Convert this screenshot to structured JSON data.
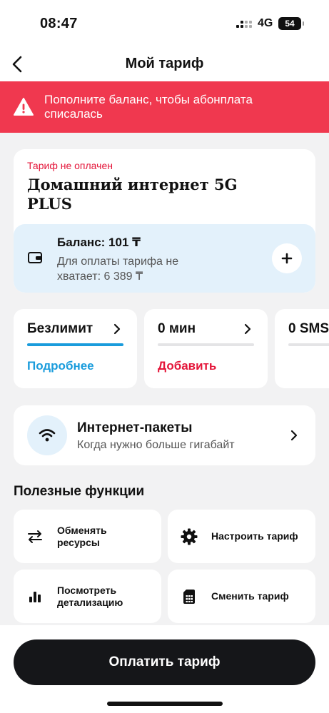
{
  "status_bar": {
    "time": "08:47",
    "network": "4G",
    "battery": "54"
  },
  "nav": {
    "title": "Мой тариф"
  },
  "alert": {
    "text": "Пополните баланс, чтобы абонплата списалась",
    "color": "#f0384f"
  },
  "tariff": {
    "status": "Тариф не оплачен",
    "name": "Домашний интернет 5G PLUS",
    "balance_title": "Баланс: 101 ₸",
    "balance_note": "Для оплаты тарифа не хватает: 6 389 ₸"
  },
  "resources": [
    {
      "title": "Безлимит",
      "progress": 1.0,
      "link": "Подробнее",
      "link_color": "#1a9cdc"
    },
    {
      "title": "0 мин",
      "progress": 0.0,
      "link": "Добавить",
      "link_color": "#e4163a"
    },
    {
      "title": "0 SMS",
      "progress": 0.0,
      "link": "",
      "link_color": "#e4163a"
    }
  ],
  "packages": {
    "title": "Интернет-пакеты",
    "subtitle": "Когда нужно больше гигабайт"
  },
  "useful": {
    "title": "Полезные функции",
    "items": [
      {
        "label": "Обменять ресурсы",
        "icon": "exchange-icon"
      },
      {
        "label": "Настроить тариф",
        "icon": "gear-icon"
      },
      {
        "label": "Посмотреть детализацию",
        "icon": "bar-chart-icon"
      },
      {
        "label": "Сменить тариф",
        "icon": "sim-card-icon"
      }
    ]
  },
  "pay_button": {
    "label": "Оплатить тариф"
  }
}
